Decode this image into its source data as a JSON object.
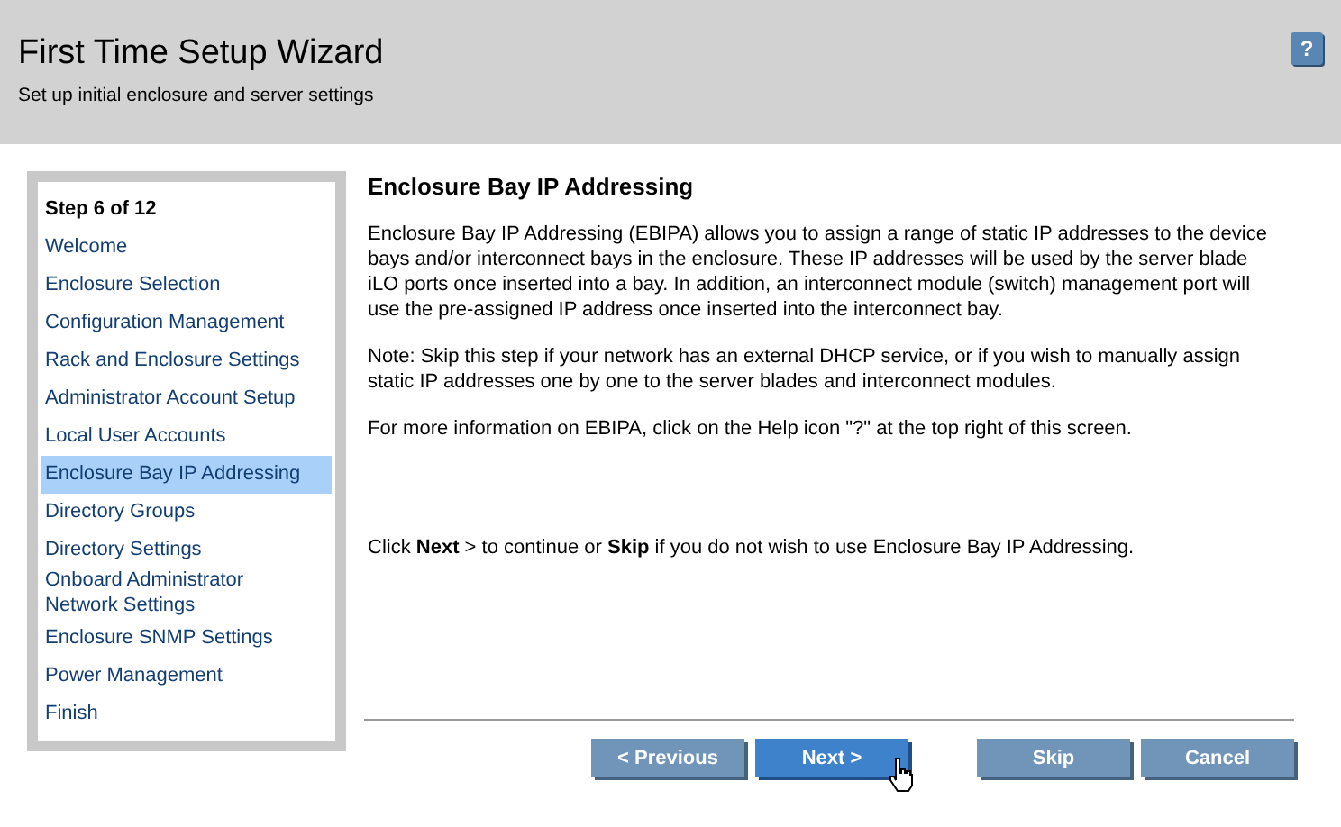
{
  "header": {
    "title": "First Time Setup Wizard",
    "subtitle": "Set up initial enclosure and server settings",
    "help_label": "?"
  },
  "sidebar": {
    "step_label": "Step 6 of 12",
    "items": [
      {
        "label": "Welcome",
        "selected": false
      },
      {
        "label": "Enclosure Selection",
        "selected": false
      },
      {
        "label": "Configuration Management",
        "selected": false
      },
      {
        "label": "Rack and Enclosure Settings",
        "selected": false
      },
      {
        "label": "Administrator Account Setup",
        "selected": false
      },
      {
        "label": "Local User Accounts",
        "selected": false
      },
      {
        "label": "Enclosure Bay IP Addressing",
        "selected": true
      },
      {
        "label": "Directory Groups",
        "selected": false
      },
      {
        "label": "Directory Settings",
        "selected": false
      },
      {
        "label": "Onboard Administrator\nNetwork Settings",
        "selected": false
      },
      {
        "label": "Enclosure SNMP Settings",
        "selected": false
      },
      {
        "label": "Power Management",
        "selected": false
      },
      {
        "label": "Finish",
        "selected": false
      }
    ]
  },
  "content": {
    "heading": "Enclosure Bay IP Addressing",
    "paragraphs": [
      "Enclosure Bay IP Addressing (EBIPA) allows you to assign a range of static IP addresses to the device bays and/or interconnect bays in the enclosure. These IP addresses will be used by the server blade iLO ports once inserted into a bay. In addition, an interconnect module (switch) management port will use the pre-assigned IP address once inserted into the interconnect bay.",
      "Note: Skip this step if your network has an external DHCP service, or if you wish to manually assign static IP addresses one by one to the server blades and interconnect modules.",
      "For more information on EBIPA, click on the Help icon \"?\" at the top right of this screen."
    ],
    "instruction": "Click **Next** > to continue or **Skip** if you do not wish to use Enclosure Bay IP Addressing."
  },
  "buttons": [
    {
      "label": "< Previous",
      "highlighted": false,
      "hovered": false
    },
    {
      "label": "Next >",
      "highlighted": true,
      "hovered": true
    },
    {
      "label": "Skip",
      "highlighted": false,
      "hovered": false
    },
    {
      "label": "Cancel",
      "highlighted": false,
      "hovered": false
    }
  ]
}
